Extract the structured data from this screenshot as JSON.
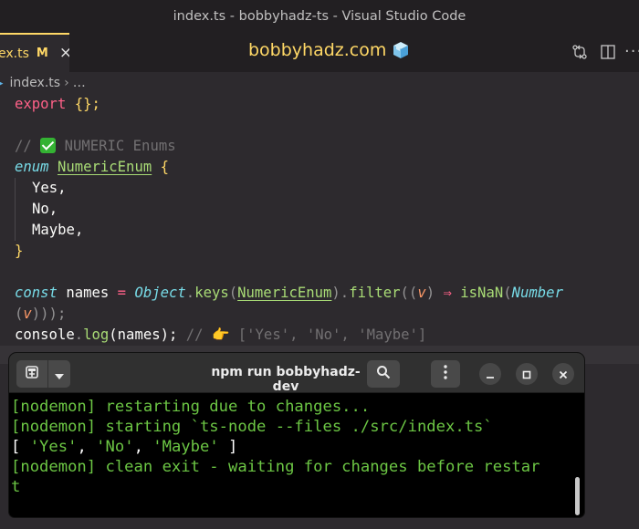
{
  "window": {
    "title": "index.ts - bobbyhadz-ts - Visual Studio Code"
  },
  "tab": {
    "name": "ex.ts",
    "modified": "M",
    "close": "×"
  },
  "banner": {
    "text": "bobbyhadz.com"
  },
  "breadcrumb": {
    "file": "index.ts",
    "separator": "›",
    "more": "…"
  },
  "code": {
    "l1": {
      "kw": "export",
      "rest": "{};"
    },
    "l3": {
      "slashes": "//",
      "text": "NUMERIC Enums"
    },
    "l4": {
      "kw": "enum",
      "name": "NumericEnum",
      "brace": "{"
    },
    "l5": "Yes,",
    "l6": "No,",
    "l7": "Maybe,",
    "l8": "}",
    "l10": {
      "kw": "const",
      "var": " names ",
      "eq": "=",
      "obj": "Object",
      "dot1": ".",
      "keys": "keys",
      "p1": "(",
      "arg": "NumericEnum",
      "p2": ").",
      "filter": "filter",
      "p3": "((",
      "v": "v",
      "p4": ")",
      "arrow": "⇒",
      "isnan": "isNaN",
      "p5": "(",
      "num": "Number"
    },
    "l11": {
      "p1": "(",
      "v": "v",
      "p2": ")));"
    },
    "l12": {
      "console": "console",
      "dot": ".",
      "log": "log",
      "args": "(names);",
      "comment": "//",
      "hand": "👉",
      "result": "['Yes', 'No', 'Maybe']"
    }
  },
  "terminal": {
    "title": "npm run bobbyhadz-dev",
    "lines": [
      "[nodemon] restarting due to changes...",
      "[nodemon] starting `ts-node --files ./src/index.ts`",
      "[ 'Yes', 'No', 'Maybe' ]",
      "[nodemon] clean exit - waiting for changes before restar",
      "t"
    ]
  }
}
